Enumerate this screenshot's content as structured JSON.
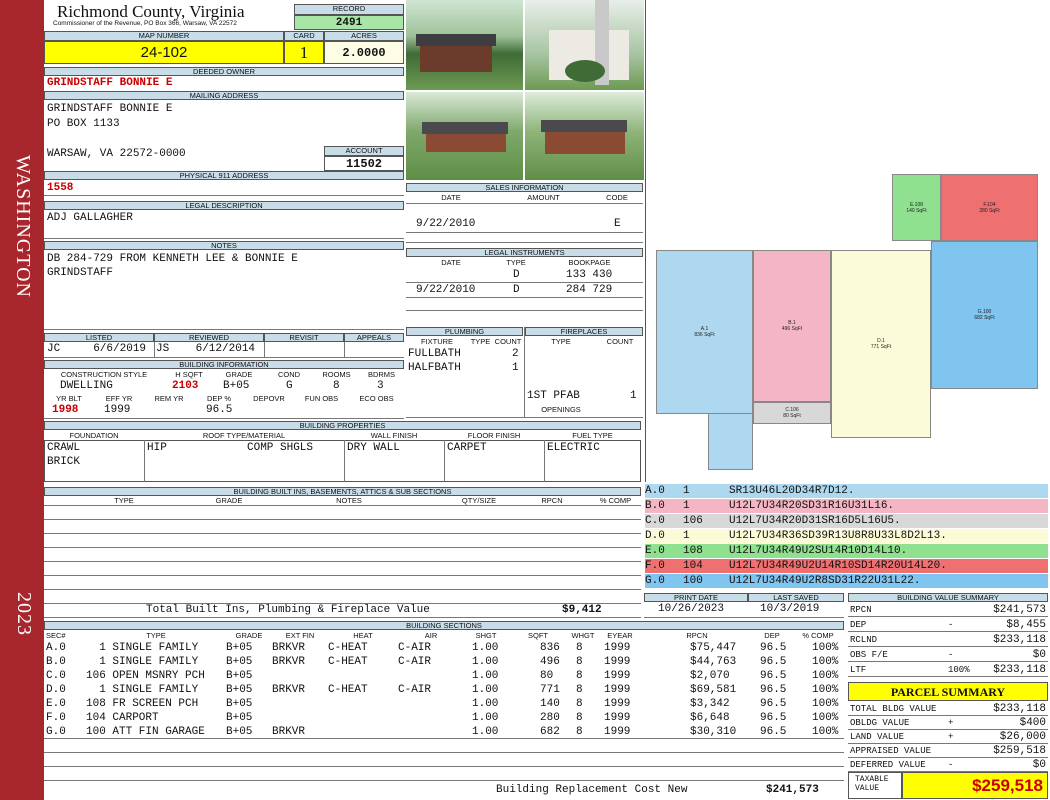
{
  "sidebar": {
    "district": "WASHINGTON",
    "year": "2023"
  },
  "header": {
    "county": "Richmond County, Virginia",
    "commissioner": "Commissioner of the Revenue, PO Box 366, Warsaw, VA 22572",
    "record_label": "RECORD",
    "record": "2491",
    "map_label": "MAP NUMBER",
    "map_number": "24-102",
    "card_label": "CARD",
    "card": "1",
    "acres_label": "ACRES",
    "acres": "2.0000"
  },
  "owner": {
    "deeded_label": "DEEDED OWNER",
    "deeded_owner": "GRINDSTAFF BONNIE E",
    "mailing_label": "MAILING ADDRESS",
    "mailing_line1": "GRINDSTAFF BONNIE E",
    "mailing_line2": "PO BOX 1133",
    "mailing_line3": "WARSAW, VA 22572-0000",
    "account_label": "ACCOUNT",
    "account": "11502",
    "physical_label": "PHYSICAL 911 ADDRESS",
    "physical": "1558"
  },
  "legal": {
    "label": "LEGAL DESCRIPTION",
    "text": "ADJ GALLAGHER"
  },
  "notes": {
    "label": "NOTES",
    "line1": "DB 284-729 FROM KENNETH LEE & BONNIE E",
    "line2": "GRINDSTAFF"
  },
  "review": {
    "listed_label": "LISTED",
    "reviewed_label": "REVIEWED",
    "revisit_label": "REVISIT",
    "appeals_label": "APPEALS",
    "listed": "JC     6/6/2019",
    "reviewed": "JS    6/12/2014"
  },
  "building_info": {
    "label": "BUILDING INFORMATION",
    "cols": [
      "CONSTRUCTION STYLE",
      "H SQFT",
      "GRADE",
      "COND",
      "ROOMS",
      "BDRMS"
    ],
    "style": "DWELLING",
    "hsqft": "2103",
    "grade": "B+05",
    "cond": "G",
    "rooms": "8",
    "bdrms": "3",
    "cols2": [
      "YR BLT",
      "EFF YR",
      "REM YR",
      "DEP %",
      "DEPOVR",
      "FUN OBS",
      "ECO OBS"
    ],
    "yrblt": "1998",
    "effyr": "1999",
    "dep": "96.5"
  },
  "sales": {
    "label": "SALES INFORMATION",
    "cols": [
      "DATE",
      "AMOUNT",
      "CODE"
    ],
    "date": "9/22/2010",
    "code": "E"
  },
  "instruments": {
    "label": "LEGAL INSTRUMENTS",
    "cols": [
      "DATE",
      "TYPE",
      "BOOKPAGE"
    ],
    "rows": [
      {
        "date": "",
        "type": "D",
        "bp": "133 430"
      },
      {
        "date": "9/22/2010",
        "type": "D",
        "bp": "284 729"
      }
    ]
  },
  "plumbing": {
    "label": "PLUMBING",
    "cols": [
      "FIXTURE",
      "TYPE",
      "COUNT"
    ],
    "r1": "FULLBATH",
    "r1c": "2",
    "r2": "HALFBATH",
    "r2c": "1"
  },
  "fireplaces": {
    "label": "FIREPLACES",
    "cols": [
      "TYPE",
      "COUNT"
    ],
    "r1": "1ST PFAB",
    "r1c": "1",
    "openings": "OPENINGS"
  },
  "properties": {
    "label": "BUILDING PROPERTIES",
    "cols": [
      "FOUNDATION",
      "ROOF TYPE/MATERIAL",
      "WALL FINISH",
      "FLOOR FINISH",
      "FUEL TYPE"
    ],
    "foundation1": "CRAWL",
    "foundation2": "BRICK",
    "roof": "HIP",
    "roofmat": "COMP SHGLS",
    "wall": "DRY WALL",
    "floor": "CARPET",
    "fuel": "ELECTRIC"
  },
  "builtins": {
    "label": "BUILDING BUILT INS, BASEMENTS, ATTICS & SUB SECTIONS",
    "cols": [
      "TYPE",
      "GRADE",
      "NOTES",
      "QTY/SIZE",
      "RPCN",
      "% COMP"
    ],
    "total_label": "Total Built Ins, Plumbing & Fireplace Value",
    "total": "$9,412"
  },
  "dates": {
    "print_label": "PRINT DATE",
    "print": "10/26/2023",
    "saved_label": "LAST SAVED",
    "saved": "10/3/2019"
  },
  "legend": [
    {
      "sec": "A.0",
      "code": "1",
      "desc": "SR13U46L20D34R7D12.",
      "color": "#add8ef"
    },
    {
      "sec": "B.0",
      "code": "1",
      "desc": "U12L7U34R20SD31R16U31L16.",
      "color": "#f4b6c4"
    },
    {
      "sec": "C.0",
      "code": "106",
      "desc": "U12L7U34R20D31SR16D5L16U5.",
      "color": "#d8d8d8"
    },
    {
      "sec": "D.0",
      "code": "1",
      "desc": "U12L7U34R36SD39R13U8R8U33L8D2L13.",
      "color": "#fbfbd8"
    },
    {
      "sec": "E.0",
      "code": "108",
      "desc": "U12L7U34R49U2SU14R10D14L10.",
      "color": "#8fe08f"
    },
    {
      "sec": "F.0",
      "code": "104",
      "desc": "U12L7U34R49U2U14R10SD14R20U14L20.",
      "color": "#ee7070"
    },
    {
      "sec": "G.0",
      "code": "100",
      "desc": "U12L7U34R49U2R8SD31R22U31L22.",
      "color": "#80c4f0"
    }
  ],
  "sections": {
    "label": "BUILDING SECTIONS",
    "cols": [
      "SEC#",
      "TYPE",
      "GRADE",
      "EXT FIN",
      "HEAT",
      "AIR",
      "SHGT",
      "SQFT",
      "WHGT",
      "EYEAR",
      "RPCN",
      "DEP",
      "% COMP"
    ],
    "rows": [
      {
        "sec": "A.0",
        "type": "  1 SINGLE FAMILY",
        "grade": "B+05",
        "ext": "BRKVR",
        "heat": "C-HEAT",
        "air": "C-AIR",
        "shgt": "1.00",
        "sqft": "836",
        "whgt": "8",
        "eyear": "1999",
        "rpcn": "$75,447",
        "dep": "96.5",
        "comp": "100%"
      },
      {
        "sec": "B.0",
        "type": "  1 SINGLE FAMILY",
        "grade": "B+05",
        "ext": "BRKVR",
        "heat": "C-HEAT",
        "air": "C-AIR",
        "shgt": "1.00",
        "sqft": "496",
        "whgt": "8",
        "eyear": "1999",
        "rpcn": "$44,763",
        "dep": "96.5",
        "comp": "100%"
      },
      {
        "sec": "C.0",
        "type": "106 OPEN MSNRY PCH",
        "grade": "B+05",
        "ext": "",
        "heat": "",
        "air": "",
        "shgt": "1.00",
        "sqft": "80",
        "whgt": "8",
        "eyear": "1999",
        "rpcn": "$2,070",
        "dep": "96.5",
        "comp": "100%"
      },
      {
        "sec": "D.0",
        "type": "  1 SINGLE FAMILY",
        "grade": "B+05",
        "ext": "BRKVR",
        "heat": "C-HEAT",
        "air": "C-AIR",
        "shgt": "1.00",
        "sqft": "771",
        "whgt": "8",
        "eyear": "1999",
        "rpcn": "$69,581",
        "dep": "96.5",
        "comp": "100%"
      },
      {
        "sec": "E.0",
        "type": "108 FR SCREEN PCH",
        "grade": "B+05",
        "ext": "",
        "heat": "",
        "air": "",
        "shgt": "1.00",
        "sqft": "140",
        "whgt": "8",
        "eyear": "1999",
        "rpcn": "$3,342",
        "dep": "96.5",
        "comp": "100%"
      },
      {
        "sec": "F.0",
        "type": "104 CARPORT",
        "grade": "B+05",
        "ext": "",
        "heat": "",
        "air": "",
        "shgt": "1.00",
        "sqft": "280",
        "whgt": "8",
        "eyear": "1999",
        "rpcn": "$6,648",
        "dep": "96.5",
        "comp": "100%"
      },
      {
        "sec": "G.0",
        "type": "100 ATT FIN GARAGE",
        "grade": "B+05",
        "ext": "BRKVR",
        "heat": "",
        "air": "",
        "shgt": "1.00",
        "sqft": "682",
        "whgt": "8",
        "eyear": "1999",
        "rpcn": "$30,310",
        "dep": "96.5",
        "comp": "100%"
      }
    ],
    "total_label": "Building Replacement Cost New",
    "total": "$241,573"
  },
  "value_summary": {
    "label": "BUILDING VALUE SUMMARY",
    "rows": [
      {
        "label": "RPCN",
        "sign": "",
        "value": "$241,573"
      },
      {
        "label": "DEP",
        "sign": "-",
        "value": "$8,455"
      },
      {
        "label": "RCLND",
        "sign": "",
        "value": "$233,118"
      },
      {
        "label": "OBS F/E",
        "sign": "-",
        "value": "$0"
      },
      {
        "label": "LTF",
        "sign": "100%",
        "value": "$233,118"
      }
    ]
  },
  "parcel": {
    "label": "PARCEL SUMMARY",
    "rows": [
      {
        "label": "TOTAL BLDG VALUE",
        "sign": "",
        "value": "$233,118"
      },
      {
        "label": "OBLDG VALUE",
        "sign": "+",
        "value": "$400"
      },
      {
        "label": "LAND VALUE",
        "sign": "+",
        "value": "$26,000"
      },
      {
        "label": "APPRAISED VALUE",
        "sign": "",
        "value": "$259,518"
      },
      {
        "label": "DEFERRED VALUE",
        "sign": "-",
        "value": "$0"
      }
    ],
    "taxable_label1": "TAXABLE",
    "taxable_label2": "VALUE",
    "taxable": "$259,518"
  },
  "sketch": {
    "rooms": [
      {
        "id": "A",
        "text": "A.1\n836 SqFt"
      },
      {
        "id": "B",
        "text": "B.1\n496 SqFt"
      },
      {
        "id": "C",
        "text": "C.106\n80 SqFt"
      },
      {
        "id": "D",
        "text": "D.1\n771 SqFt"
      },
      {
        "id": "E",
        "text": "E.108\n140 SqFt"
      },
      {
        "id": "F",
        "text": "F.104\n280 SqFt"
      },
      {
        "id": "G",
        "text": "G.100\n682 SqFt"
      }
    ]
  }
}
